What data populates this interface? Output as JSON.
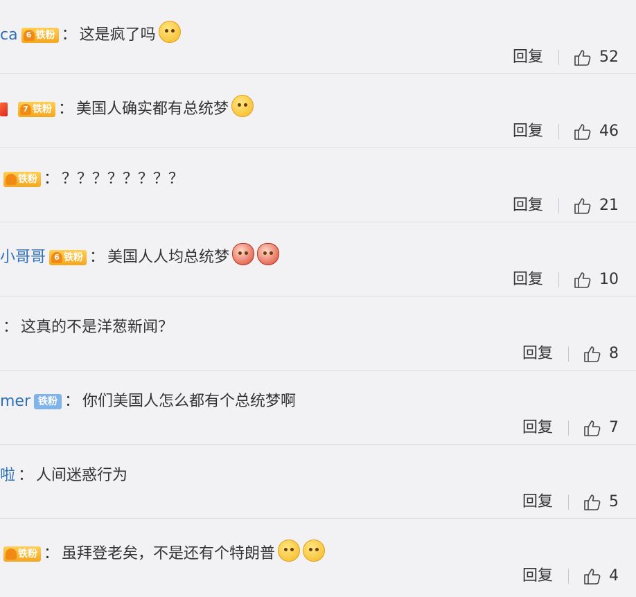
{
  "comments": [
    {
      "user": "ca",
      "stub": false,
      "badge": {
        "text": "铁粉",
        "level": "6",
        "style": "gold"
      },
      "sep": "：",
      "text": "这是疯了吗",
      "emojis": [
        "confused-emoji"
      ],
      "reply": "回复",
      "likes": "52"
    },
    {
      "user": "",
      "stub": true,
      "badge": {
        "text": "铁粉",
        "level": "7",
        "style": "gold"
      },
      "sep": "：",
      "text": "美国人确实都有总统梦",
      "emojis": [
        "cat-emoji"
      ],
      "reply": "回复",
      "likes": "46"
    },
    {
      "user": "",
      "stub": false,
      "badge": {
        "text": "铁粉",
        "level": "",
        "style": "gold"
      },
      "sep": "：",
      "text": "？？？？？？？？",
      "emojis": [],
      "reply": "回复",
      "likes": "21"
    },
    {
      "user": "小哥哥",
      "stub": false,
      "badge": {
        "text": "铁粉",
        "level": "6",
        "style": "gold"
      },
      "sep": "：",
      "text": "美国人人均总统梦",
      "emojis": [
        "red-envelope-emoji",
        "red-envelope-emoji"
      ],
      "reply": "回复",
      "likes": "10"
    },
    {
      "user": "",
      "stub": false,
      "badge": null,
      "sep": "：",
      "text": "这真的不是洋葱新闻？",
      "emojis": [],
      "reply": "回复",
      "likes": "8"
    },
    {
      "user": "mer",
      "stub": false,
      "badge": {
        "text": "铁粉",
        "level": "",
        "style": "blue"
      },
      "sep": "：",
      "text": "你们美国人怎么都有个总统梦啊",
      "emojis": [],
      "reply": "回复",
      "likes": "7"
    },
    {
      "user": "啦",
      "stub": false,
      "badge": null,
      "sep": "：",
      "text": "人间迷惑行为",
      "emojis": [],
      "reply": "回复",
      "likes": "5"
    },
    {
      "user": "",
      "stub": false,
      "badge": {
        "text": "铁粉",
        "level": "",
        "style": "gold"
      },
      "sep": "：",
      "text": "虽拜登老矣，不是还有个特朗普",
      "emojis": [
        "laughing-emoji",
        "laughing-emoji"
      ],
      "reply": "回复",
      "likes": "4"
    }
  ]
}
